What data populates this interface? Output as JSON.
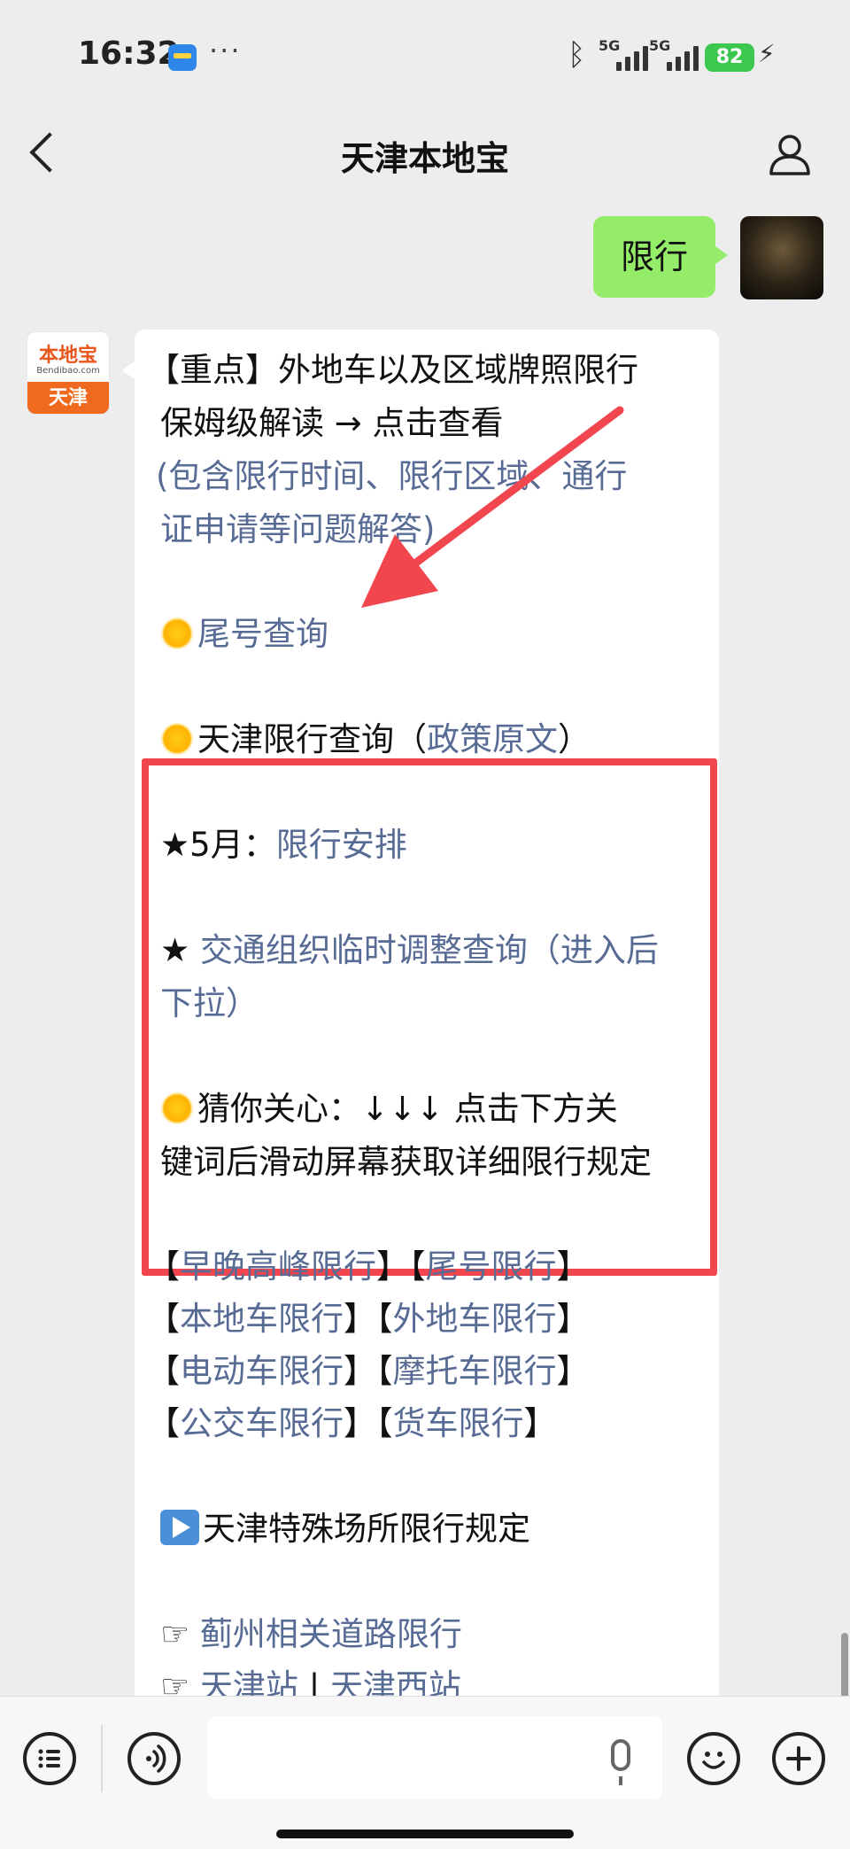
{
  "status_bar": {
    "time": "16:32",
    "signal1": "5G",
    "signal2": "5G",
    "battery": "82"
  },
  "nav": {
    "title": "天津本地宝"
  },
  "user_message": {
    "text": "限行"
  },
  "bot": {
    "avatar_brand": "本地宝",
    "avatar_url": "Bendibao.com",
    "avatar_city": "天津",
    "headline_line1": "【重点】外地车以及区域牌照限行",
    "headline_line2": "保姆级解读 → 点击查看",
    "note_line1": "(包含限行时间、限行区域、通行",
    "note_line2": "证申请等问题解答)",
    "tail_query": "尾号查询",
    "tianjin_query": "天津限行查询（",
    "policy_link": "政策原文",
    "close_paren": "）",
    "may_prefix": "★5月：",
    "may_link": "限行安排",
    "star": "★ ",
    "traffic_line1": "交通组织临时调整查询（进入后",
    "traffic_line2": "下拉）",
    "guess_line1": "猜你关心：↓↓↓ 点击下方关",
    "guess_line2": "键词后滑动屏幕获取详细限行规定",
    "bracket_open": "【",
    "bracket_close": "】",
    "keywords_row1": [
      "早晚高峰限行",
      "尾号限行"
    ],
    "keywords_row2": [
      "本地车限行",
      "外地车限行"
    ],
    "keywords_row3": [
      "电动车限行",
      "摩托车限行"
    ],
    "keywords_row4": [
      "公交车限行",
      "货车限行"
    ],
    "special_title": "天津特殊场所限行规定",
    "hand": "☞ ",
    "jizhou_link": "蓟州相关道路限行",
    "station1": "天津站",
    "divider": " | ",
    "station2": "天津西站"
  },
  "colors": {
    "bubble_green": "#95ec69",
    "link_blue": "#576b95",
    "highlight_red": "#f2464f"
  }
}
